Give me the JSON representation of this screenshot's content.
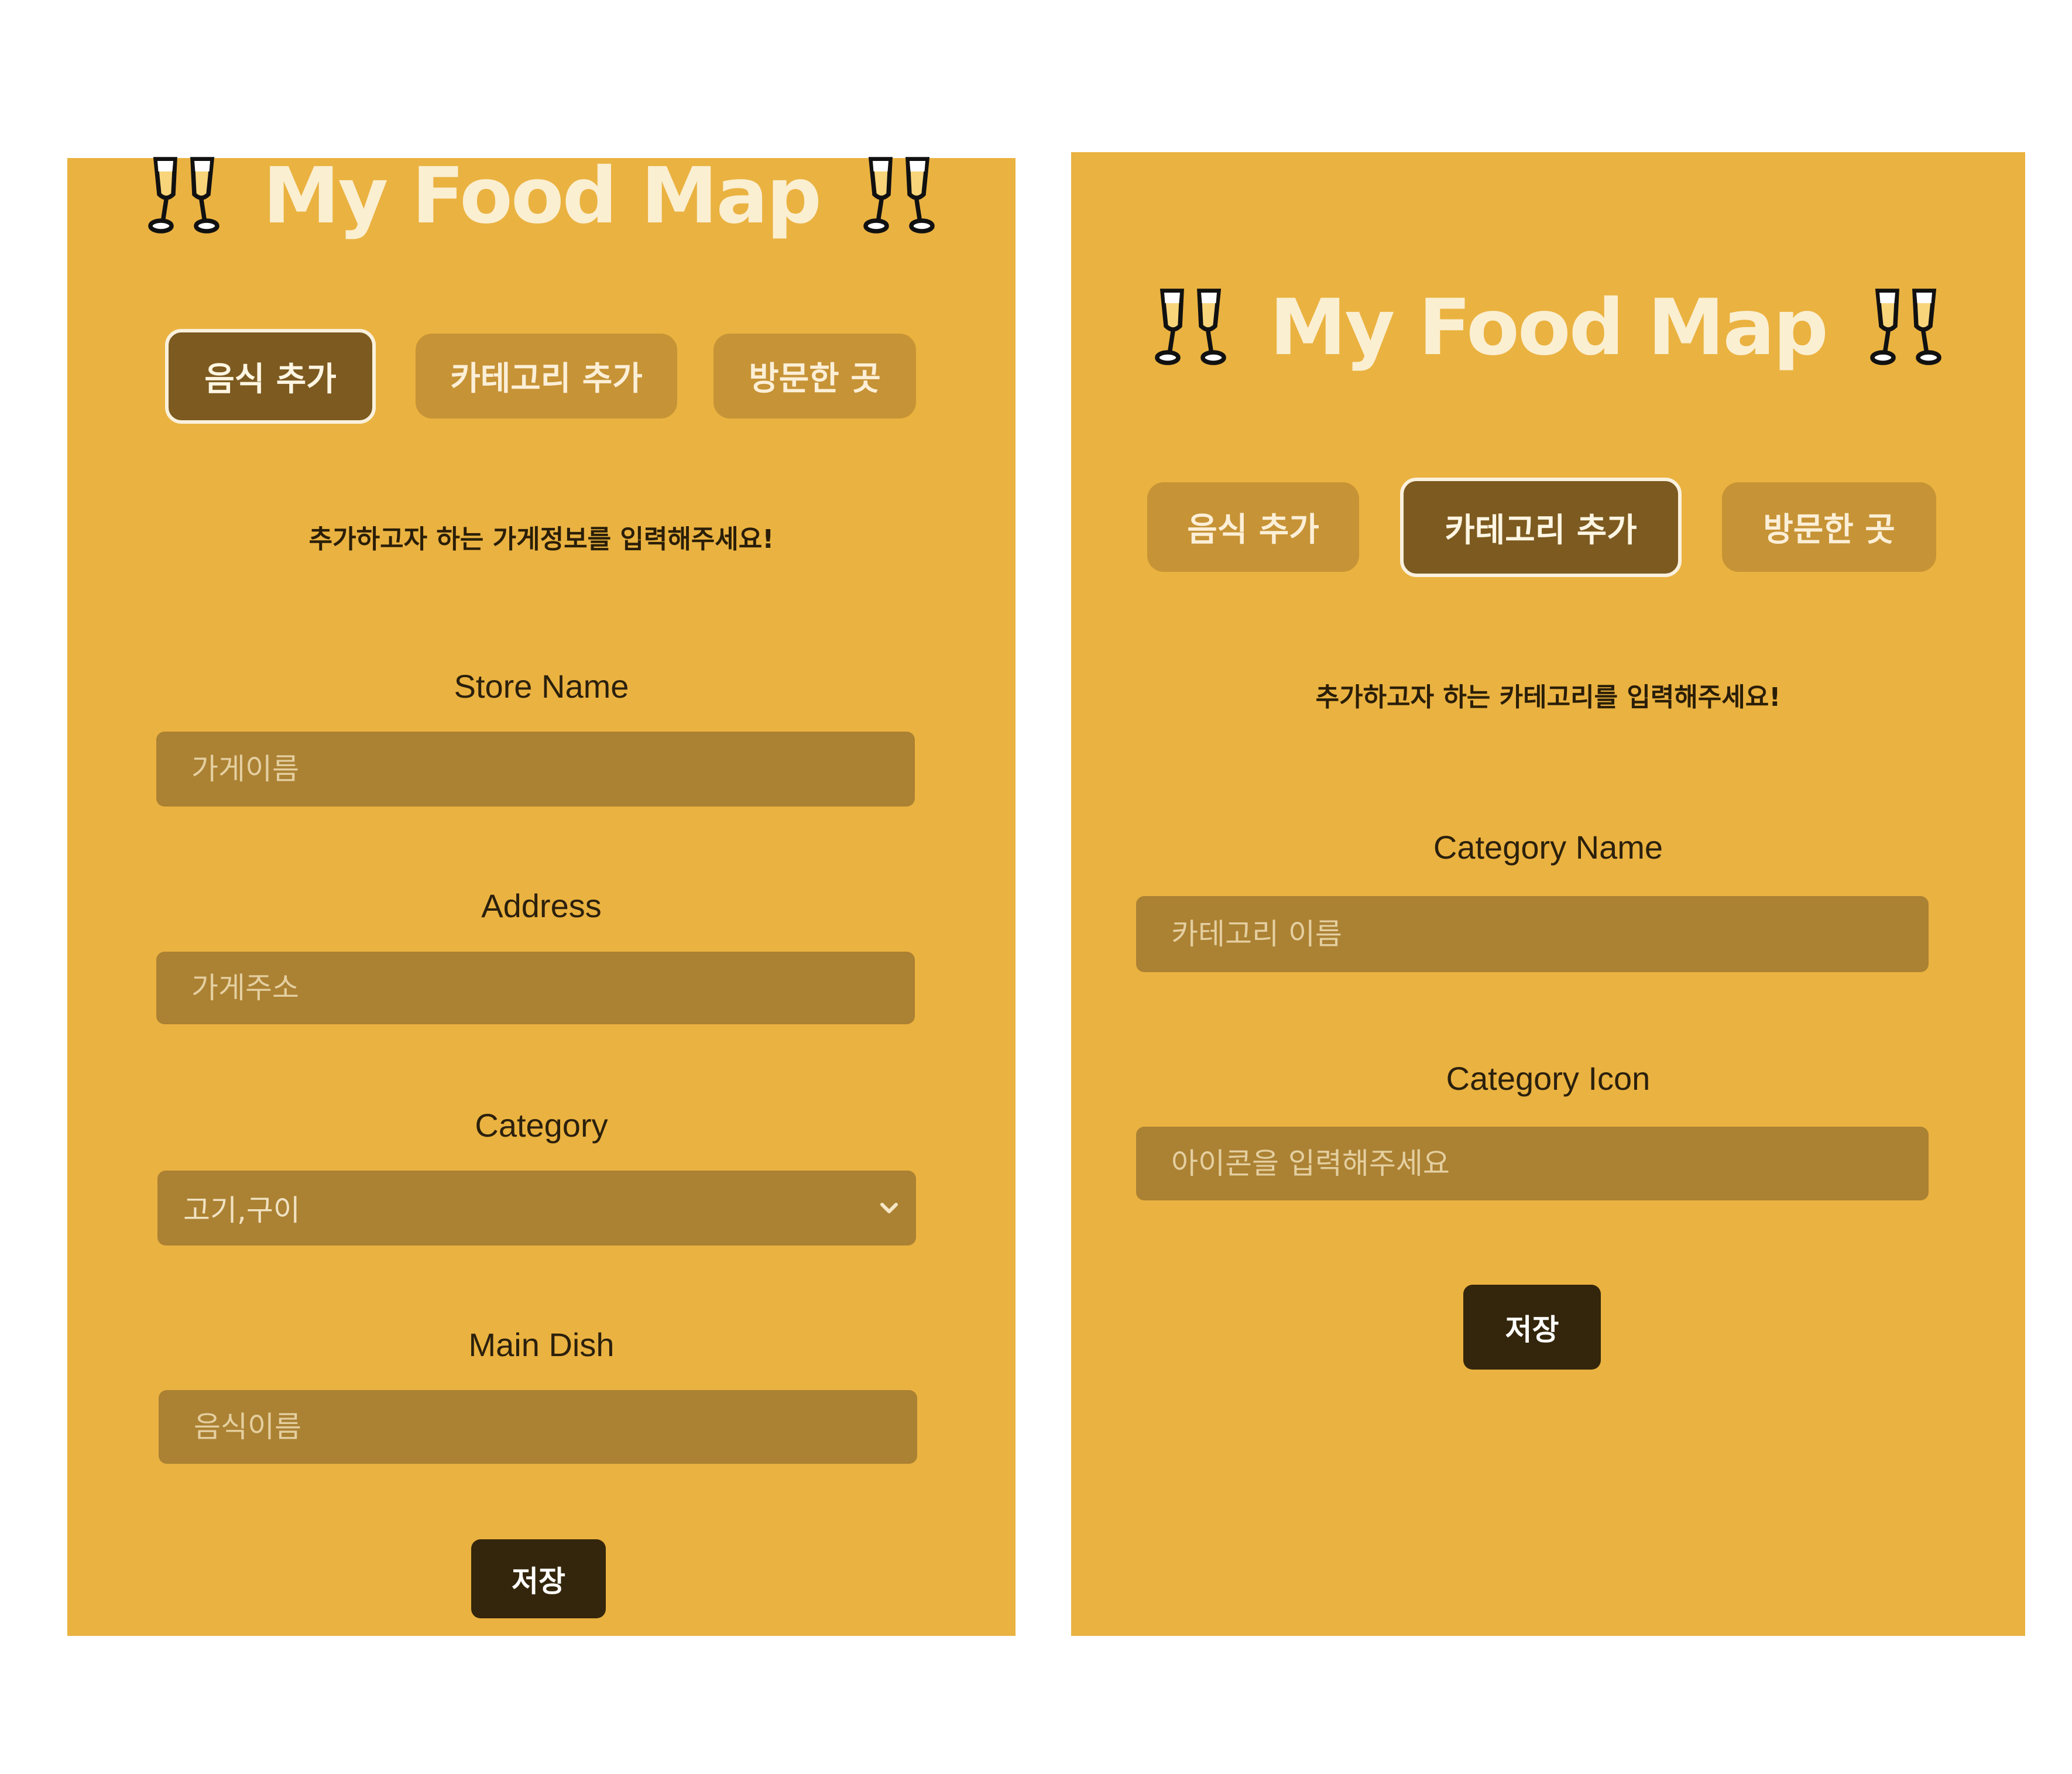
{
  "colors": {
    "panel_bg": "#EAB240",
    "tab_bg": "#C69336",
    "tab_active_bg": "#7C5A20",
    "input_bg": "#AB8133",
    "button_bg": "#34260C",
    "title_text": "#FBEFD2"
  },
  "left_screen": {
    "app_title": "My Food Map",
    "title_icon": "cheers-glasses-icon",
    "tabs": [
      {
        "label": "음식 추가",
        "active": true
      },
      {
        "label": "카테고리 추가",
        "active": false
      },
      {
        "label": "방문한 곳",
        "active": false
      }
    ],
    "instruction": "추가하고자 하는 가게정보를 입력해주세요!",
    "fields": {
      "store_name": {
        "label": "Store Name",
        "placeholder": "가게이름"
      },
      "address": {
        "label": "Address",
        "placeholder": "가게주소"
      },
      "category": {
        "label": "Category",
        "selected": "고기,구이",
        "icon": "chevron-down-icon"
      },
      "main_dish": {
        "label": "Main Dish",
        "placeholder": "음식이름"
      }
    },
    "save_label": "저장"
  },
  "right_screen": {
    "app_title": "My Food Map",
    "title_icon": "cheers-glasses-icon",
    "tabs": [
      {
        "label": "음식 추가",
        "active": false
      },
      {
        "label": "카테고리 추가",
        "active": true
      },
      {
        "label": "방문한 곳",
        "active": false
      }
    ],
    "instruction": "추가하고자 하는 카테고리를 입력해주세요!",
    "fields": {
      "category_name": {
        "label": "Category Name",
        "placeholder": "카테고리 이름"
      },
      "category_icon": {
        "label": "Category Icon",
        "placeholder": "아이콘을 입력해주세요"
      }
    },
    "save_label": "저장"
  }
}
